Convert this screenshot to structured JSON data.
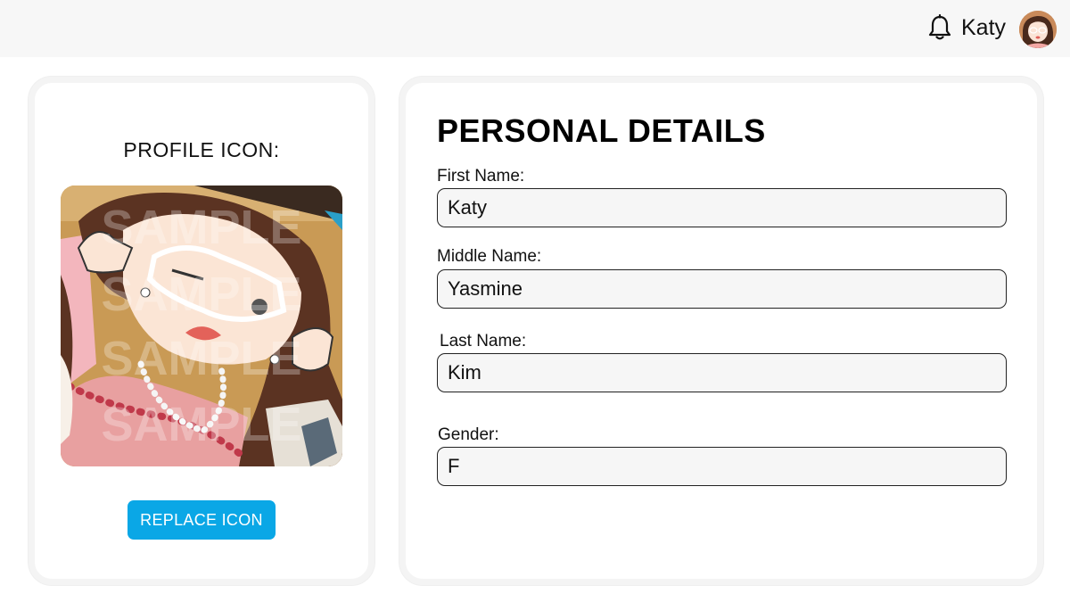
{
  "header": {
    "user_name": "Katy",
    "notification_icon": "bell-icon",
    "avatar_icon": "user-avatar"
  },
  "profile": {
    "label": "PROFILE ICON:",
    "watermark": [
      "SAMPLE",
      "SAMPLE",
      "SAMPLE",
      "SAMPLE"
    ],
    "replace_button": "REPLACE ICON",
    "accent_color": "#0aa7e6"
  },
  "details": {
    "title": "PERSONAL DETAILS",
    "fields": [
      {
        "label": "First Name:",
        "value": "Katy"
      },
      {
        "label": "Middle Name:",
        "value": "Yasmine"
      },
      {
        "label": "Last Name:",
        "value": "Kim"
      },
      {
        "label": "Gender:",
        "value": "F"
      }
    ]
  }
}
